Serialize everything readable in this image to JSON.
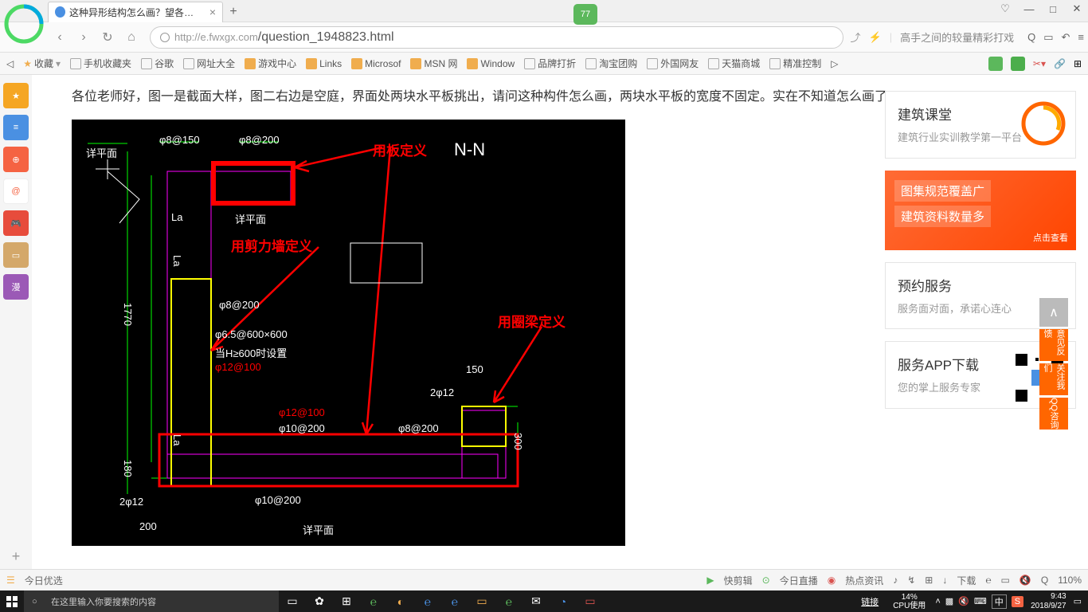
{
  "browser": {
    "tab_title": "这种异形结构怎么画？望各位老师",
    "tab_close": "×",
    "url_prefix": "http://",
    "url_host": "e.fwxgx.com",
    "url_path": "/question_1948823.html",
    "status_badge": "77",
    "search_placeholder": "高手之间的较量精彩打戏",
    "today_special": "今日优选"
  },
  "bookmarks": {
    "fav": "收藏",
    "items": [
      "手机收藏夹",
      "谷歌",
      "网址大全",
      "游戏中心",
      "Links",
      "Microsof",
      "MSN 网",
      "Window",
      "品牌打折",
      "淘宝团购",
      "外国网友",
      "天猫商城",
      "精准控制"
    ]
  },
  "sidebar": {
    "labels": [
      "★",
      "≡",
      "⊕",
      "@",
      "🎮",
      "▭",
      "漫"
    ]
  },
  "question": {
    "text": "各位老师好，图一是截面大样，图二右边是空庭，界面处两块水平板挑出，请问这种构件怎么画，两块水平板的宽度不固定。实在不知道怎么画了。"
  },
  "diagram": {
    "anno1": "用板定义",
    "anno2": "N-N",
    "anno3": "用剪力墙定义",
    "anno4": "用圈梁定义",
    "label_top1": "详平面",
    "label_top2": "φ8@150",
    "label_top3": "φ8@200",
    "label_la1": "La",
    "label_la2": "La",
    "label_la3": "La",
    "label_mid1": "详平面",
    "label_mid2": "φ8@200",
    "label_mid3": "φ6.5@600×600",
    "label_mid4": "当H≥600时设置",
    "label_mid5": "φ12@100",
    "label_mid6": "φ12@100",
    "label_bot1": "φ10@200",
    "label_bot2": "φ8@200",
    "label_bot3": "2φ12",
    "label_bot4": "详平面",
    "label_left1": "2φ12",
    "dim_1770": "1770",
    "dim_180": "180",
    "dim_200": "200",
    "dim_150": "150",
    "dim_300": "300",
    "label_bottom": "φ10@200",
    "label_bottom2": "详平面"
  },
  "right_panel": {
    "card1_title": "建筑课堂",
    "card1_sub": "建筑行业实训教学第一平台",
    "promo_line1": "图集规范覆盖广",
    "promo_line2": "建筑资料数量多",
    "promo_btn": "点击查看",
    "card2_title": "预约服务",
    "card2_sub": "服务面对面，承诺心连心",
    "card3_title": "服务APP下载",
    "card3_sub": "您的掌上服务专家"
  },
  "float": {
    "top": "∧",
    "btn1": "意见反馈",
    "btn2": "关注我们",
    "btn3": "QQ咨询"
  },
  "bottom_bar": {
    "items_left": [
      "快剪辑",
      "今日直播",
      "热点资讯"
    ],
    "download": "下载",
    "zoom": "110%"
  },
  "taskbar": {
    "search_placeholder": "在这里输入你要搜索的内容",
    "link": "链接",
    "cpu_pct": "14%",
    "cpu_label": "CPU使用",
    "ime": "中",
    "time": "9:43",
    "date": "2018/9/27"
  }
}
